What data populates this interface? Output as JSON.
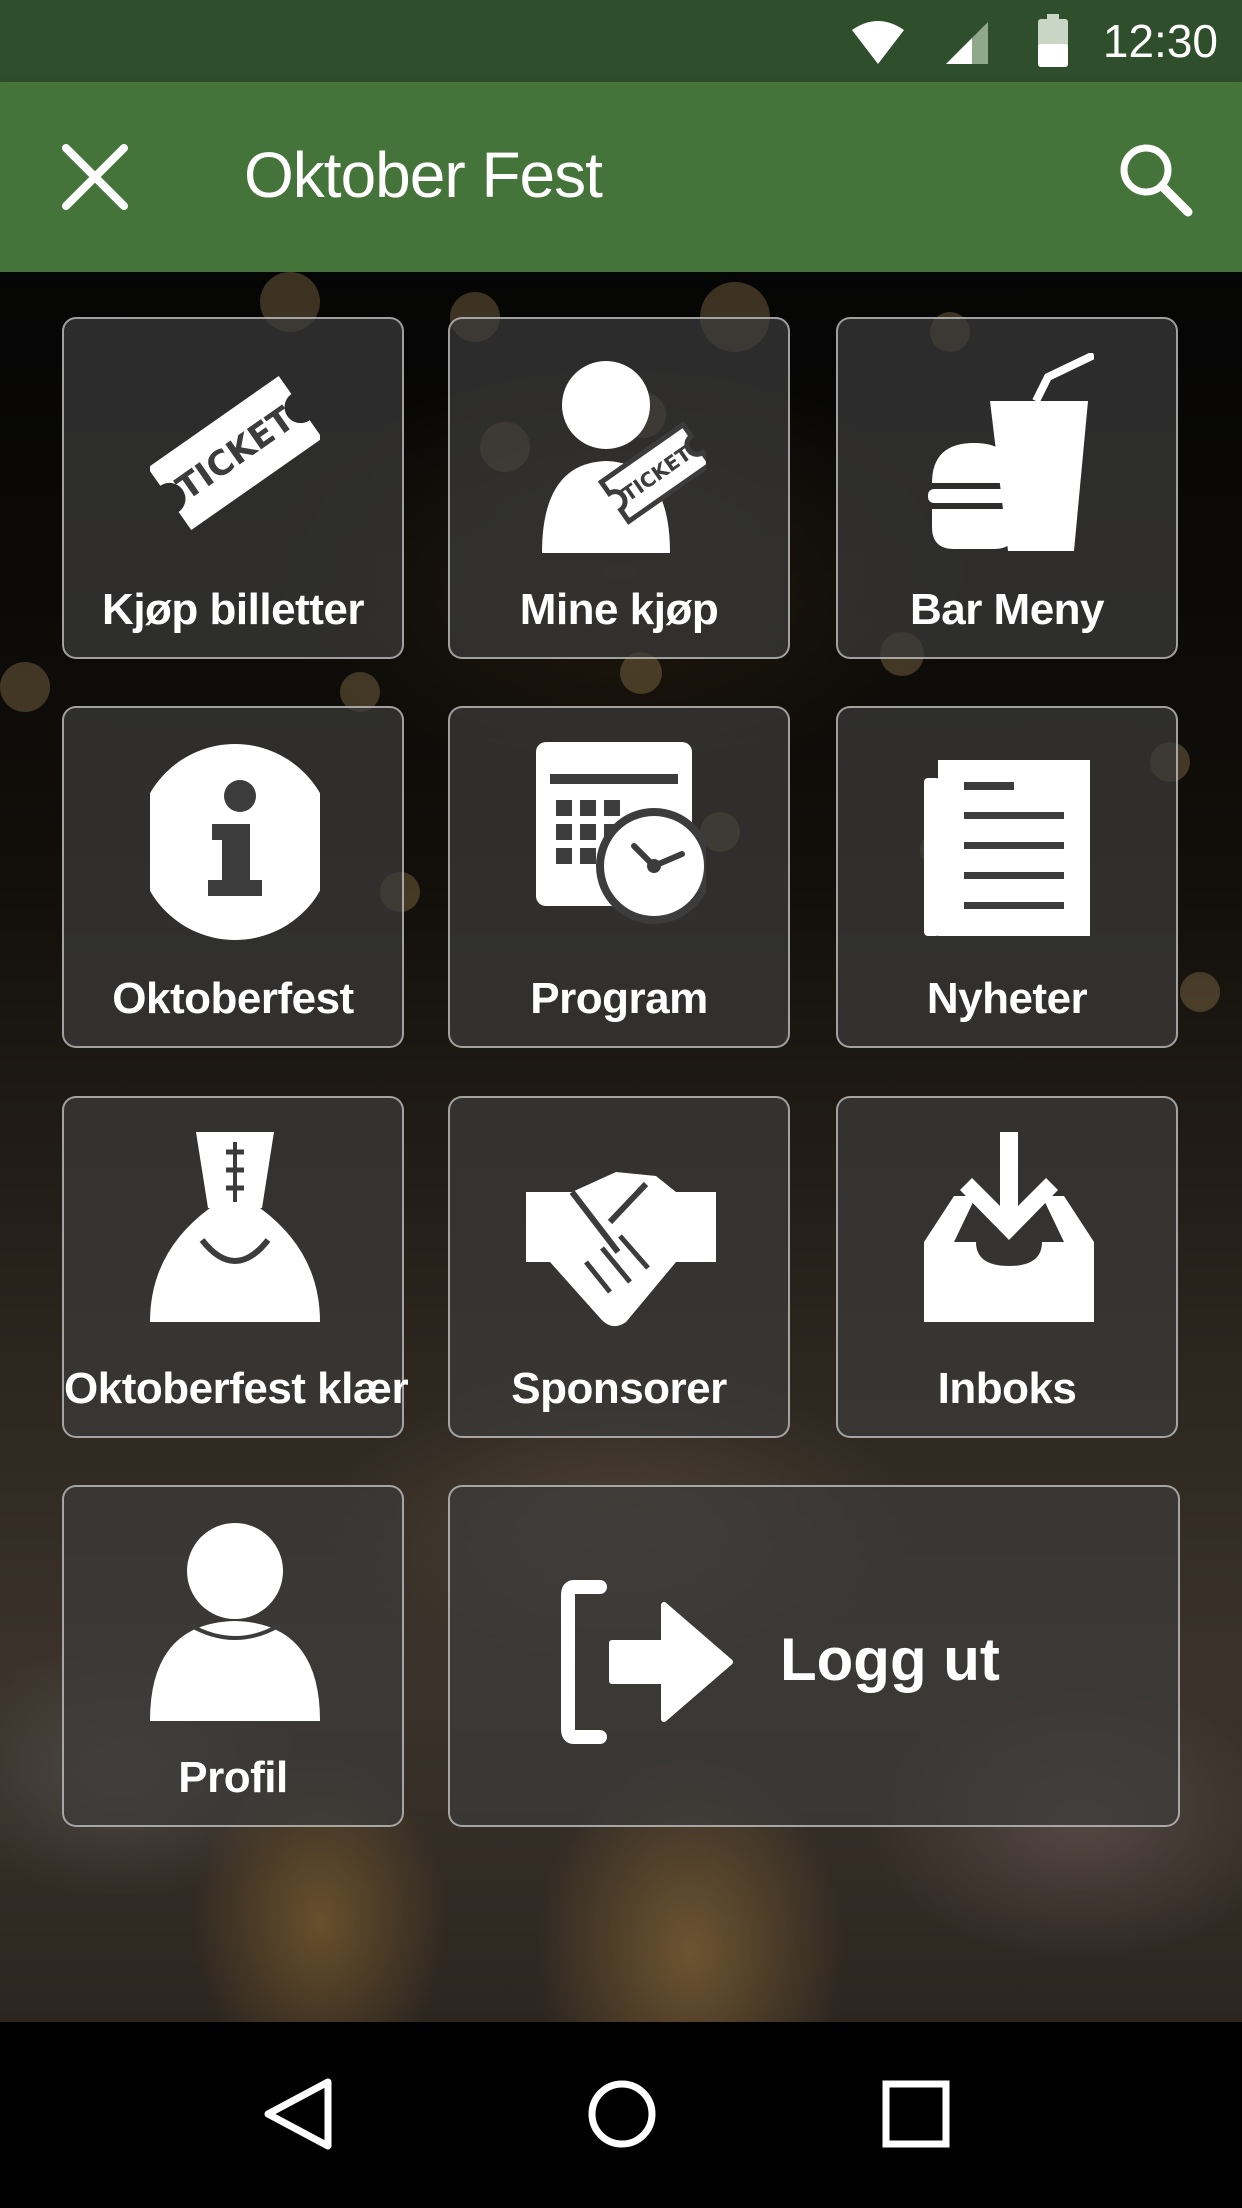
{
  "status_bar": {
    "time": "12:30",
    "icons": [
      "wifi-icon",
      "cell-signal-icon",
      "battery-icon"
    ]
  },
  "app_bar": {
    "title": "Oktober Fest",
    "close_icon": "close-icon",
    "search_icon": "search-icon"
  },
  "menu": {
    "tiles": [
      {
        "label": "Kjøp billetter",
        "icon": "ticket-icon",
        "ticket_text": "TICKET"
      },
      {
        "label": "Mine kjøp",
        "icon": "user-ticket-icon",
        "ticket_text": "TICKET"
      },
      {
        "label": "Bar Meny",
        "icon": "burger-drink-icon"
      },
      {
        "label": "Oktoberfest",
        "icon": "info-icon"
      },
      {
        "label": "Program",
        "icon": "calendar-clock-icon"
      },
      {
        "label": "Nyheter",
        "icon": "newspaper-icon"
      },
      {
        "label": "Oktoberfest klær",
        "icon": "dirndl-icon"
      },
      {
        "label": "Sponsorer",
        "icon": "handshake-icon"
      },
      {
        "label": "Inboks",
        "icon": "inbox-download-icon"
      },
      {
        "label": "Profil",
        "icon": "person-icon"
      },
      {
        "label": "Logg ut",
        "icon": "logout-icon"
      }
    ]
  },
  "nav_bar": {
    "icons": [
      "back-icon",
      "home-icon",
      "recents-icon"
    ]
  },
  "colors": {
    "status_bar": "#2f4f2c",
    "app_bar": "#44743a",
    "tile_bg": "#3c3c3c",
    "icon": "#ffffff"
  }
}
